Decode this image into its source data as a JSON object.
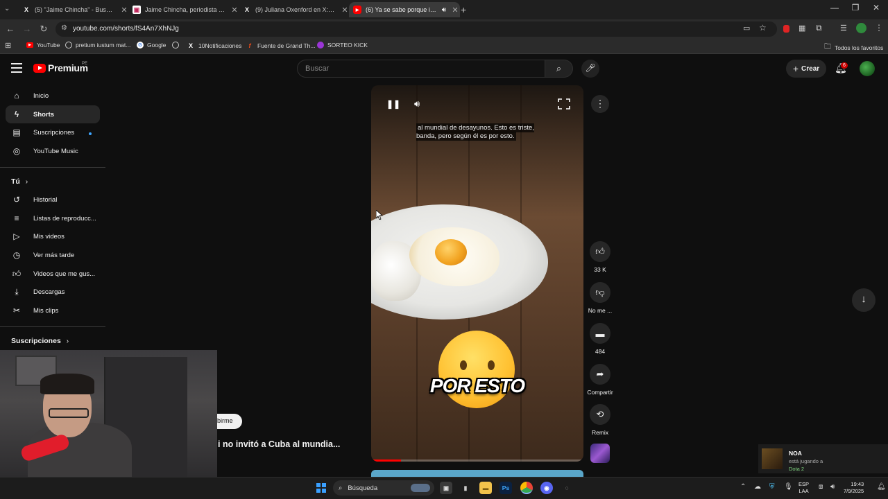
{
  "browser": {
    "tabs": [
      {
        "title": "(5) \"Jaime Chincha\" - Buscar / X"
      },
      {
        "title": "Jaime Chincha, periodista y co..."
      },
      {
        "title": "(9) Juliana Oxenford en X: \"Te v..."
      },
      {
        "title": "(6) Ya se sabe porque ibai n..."
      }
    ],
    "url": "youtube.com/shorts/fS4An7XhNJg",
    "bookmarks": [
      "YouTube",
      "pretium iustum mat...",
      "Google",
      "10Notificaciones",
      "Fuente de Grand Th...",
      "SORTEO KICK"
    ],
    "all_bookmarks": "Todos los favoritos"
  },
  "header": {
    "logo_text": "Premium",
    "region": "PE",
    "search_placeholder": "Buscar",
    "create_label": "Crear",
    "notifications_count": "6"
  },
  "sidebar": {
    "main": [
      {
        "label": "Inicio",
        "icon": "home-icon"
      },
      {
        "label": "Shorts",
        "icon": "shorts-icon",
        "selected": true
      },
      {
        "label": "Suscripciones",
        "icon": "subscriptions-icon"
      },
      {
        "label": "YouTube Music",
        "icon": "music-icon"
      }
    ],
    "you_heading": "Tú",
    "you": [
      {
        "label": "Historial",
        "icon": "history-icon"
      },
      {
        "label": "Listas de reproducc...",
        "icon": "playlist-icon"
      },
      {
        "label": "Mis videos",
        "icon": "my-videos-icon"
      },
      {
        "label": "Ver más tarde",
        "icon": "clock-icon"
      },
      {
        "label": "Videos que me gus...",
        "icon": "thumbs-up-icon"
      },
      {
        "label": "Descargas",
        "icon": "download-icon"
      },
      {
        "label": "Mis clips",
        "icon": "scissors-icon"
      }
    ],
    "subscriptions_heading": "Suscripciones"
  },
  "short": {
    "caption": "al mundial de desayunos. Esto es triste, banda, pero según él es por esto.",
    "overlay_text": "POR ESTO",
    "progress": 0.14,
    "subscribe_fragment": "birme",
    "title_fragment": "i no invitó a Cuba al mundia..."
  },
  "actions": {
    "likes": "33 K",
    "dislike": "No me ...",
    "comments": "484",
    "share": "Compartir",
    "remix": "Remix"
  },
  "notification": {
    "name": "NOA",
    "status": "está jugando a",
    "game": "Dota 2"
  },
  "taskbar": {
    "search_label": "Búsqueda",
    "lang_top": "ESP",
    "lang_bottom": "LAA",
    "time": "19:43",
    "date": "7/9/2025"
  }
}
